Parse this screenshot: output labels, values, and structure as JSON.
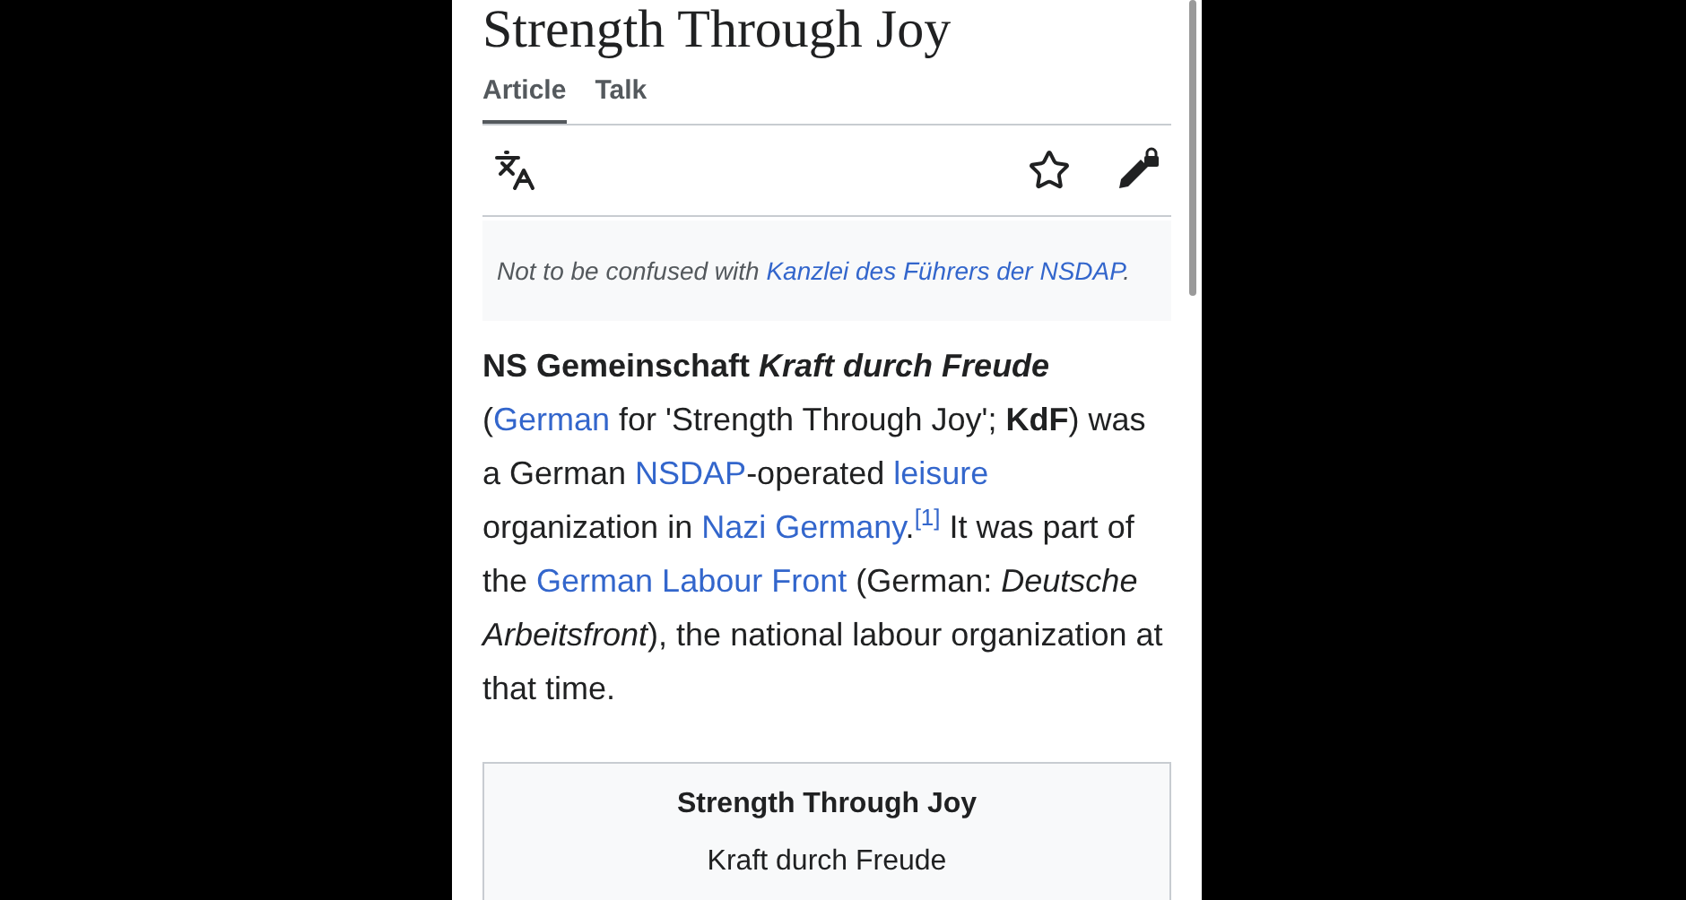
{
  "article": {
    "title": "Strength Through Joy",
    "tabs": [
      {
        "label": "Article",
        "selected": true
      },
      {
        "label": "Talk",
        "selected": false
      }
    ],
    "hatnote": {
      "text": "Not to be confused with ",
      "link": "Kanzlei des Führers der NSDAP",
      "end": "."
    },
    "lead": [
      {
        "kind": "bold",
        "text": "NS Gemeinschaft "
      },
      {
        "kind": "bolditalic",
        "text": "Kraft durch Freude"
      },
      {
        "kind": "text",
        "text": " ("
      },
      {
        "kind": "link",
        "text": "German"
      },
      {
        "kind": "text",
        "text": " for 'Strength Through Joy'; "
      },
      {
        "kind": "bold",
        "text": "KdF"
      },
      {
        "kind": "text",
        "text": ") was a German "
      },
      {
        "kind": "link",
        "text": "NSDAP"
      },
      {
        "kind": "text",
        "text": "-operated "
      },
      {
        "kind": "link",
        "text": "leisure"
      },
      {
        "kind": "text",
        "text": " organization in "
      },
      {
        "kind": "link",
        "text": "Nazi Germany"
      },
      {
        "kind": "text",
        "text": "."
      },
      {
        "kind": "ref",
        "text": "[1]"
      },
      {
        "kind": "text",
        "text": " It was part of the "
      },
      {
        "kind": "link",
        "text": "German Labour Front"
      },
      {
        "kind": "text",
        "text": " (German: "
      },
      {
        "kind": "italic",
        "text": "Deutsche Arbeitsfront"
      },
      {
        "kind": "text",
        "text": "), the national labour organization at that time."
      }
    ],
    "infobox": {
      "title": "Strength Through Joy",
      "subtitle": "Kraft durch Freude"
    }
  }
}
